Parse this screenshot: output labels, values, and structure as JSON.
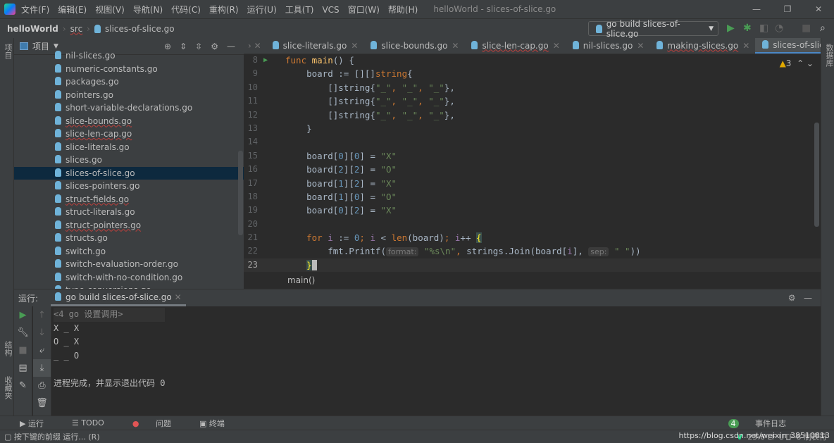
{
  "window": {
    "title": "helloWorld - slices-of-slice.go",
    "menu": [
      "文件(F)",
      "编辑(E)",
      "视图(V)",
      "导航(N)",
      "代码(C)",
      "重构(R)",
      "运行(U)",
      "工具(T)",
      "VCS",
      "窗口(W)",
      "帮助(H)"
    ]
  },
  "breadcrumb": {
    "project": "helloWorld",
    "folder": "src",
    "file": "slices-of-slice.go"
  },
  "run_config": {
    "label": "go build slices-of-slice.go"
  },
  "left_strip": {
    "project": "项目",
    "structure": "结构",
    "favorites": "收藏夹"
  },
  "right_strip": {
    "database": "数据库"
  },
  "project_panel": {
    "title": "项目",
    "files": [
      {
        "name": "nil-slices.go"
      },
      {
        "name": "numeric-constants.go"
      },
      {
        "name": "packages.go"
      },
      {
        "name": "pointers.go"
      },
      {
        "name": "short-variable-declarations.go"
      },
      {
        "name": "slice-bounds.go",
        "error": true
      },
      {
        "name": "slice-len-cap.go",
        "error": true
      },
      {
        "name": "slice-literals.go"
      },
      {
        "name": "slices.go"
      },
      {
        "name": "slices-of-slice.go",
        "selected": true
      },
      {
        "name": "slices-pointers.go"
      },
      {
        "name": "struct-fields.go",
        "error": true
      },
      {
        "name": "struct-literals.go"
      },
      {
        "name": "struct-pointers.go",
        "error": true
      },
      {
        "name": "structs.go"
      },
      {
        "name": "switch.go"
      },
      {
        "name": "switch-evaluation-order.go"
      },
      {
        "name": "switch-with-no-condition.go"
      },
      {
        "name": "type-conversions.go"
      }
    ]
  },
  "editor": {
    "tabs": [
      {
        "label": "slice-literals.go"
      },
      {
        "label": "slice-bounds.go"
      },
      {
        "label": "slice-len-cap.go",
        "error": true
      },
      {
        "label": "nil-slices.go"
      },
      {
        "label": "making-slices.go",
        "error": true
      },
      {
        "label": "slices-of-slice.go",
        "active": true
      }
    ],
    "warnings": "3",
    "breadcrumb": "main()",
    "current_line": 23,
    "lines": [
      {
        "n": 8,
        "t": [
          [
            "func ",
            "k"
          ],
          [
            "main",
            "f"
          ],
          [
            "() {",
            "d"
          ]
        ]
      },
      {
        "n": 9,
        "t": [
          [
            "    board := [][]",
            "d"
          ],
          [
            "string",
            "k"
          ],
          [
            "{",
            "d"
          ]
        ]
      },
      {
        "n": 10,
        "t": [
          [
            "        []string{",
            "d"
          ],
          [
            "\"_\"",
            "s"
          ],
          [
            ", ",
            "b"
          ],
          [
            "\"_\"",
            "s"
          ],
          [
            ", ",
            "b"
          ],
          [
            "\"_\"",
            "s"
          ],
          [
            "},",
            "d"
          ]
        ]
      },
      {
        "n": 11,
        "t": [
          [
            "        []string{",
            "d"
          ],
          [
            "\"_\"",
            "s"
          ],
          [
            ", ",
            "b"
          ],
          [
            "\"_\"",
            "s"
          ],
          [
            ", ",
            "b"
          ],
          [
            "\"_\"",
            "s"
          ],
          [
            "},",
            "d"
          ]
        ]
      },
      {
        "n": 12,
        "t": [
          [
            "        []string{",
            "d"
          ],
          [
            "\"_\"",
            "s"
          ],
          [
            ", ",
            "b"
          ],
          [
            "\"_\"",
            "s"
          ],
          [
            ", ",
            "b"
          ],
          [
            "\"_\"",
            "s"
          ],
          [
            "},",
            "d"
          ]
        ]
      },
      {
        "n": 13,
        "t": [
          [
            "    }",
            "d"
          ]
        ]
      },
      {
        "n": 14,
        "t": []
      },
      {
        "n": 15,
        "t": [
          [
            "    board[",
            "d"
          ],
          [
            "0",
            "n"
          ],
          [
            "][",
            "d"
          ],
          [
            "0",
            "n"
          ],
          [
            "] = ",
            "d"
          ],
          [
            "\"X\"",
            "s"
          ]
        ]
      },
      {
        "n": 16,
        "t": [
          [
            "    board[",
            "d"
          ],
          [
            "2",
            "n"
          ],
          [
            "][",
            "d"
          ],
          [
            "2",
            "n"
          ],
          [
            "] = ",
            "d"
          ],
          [
            "\"O\"",
            "s"
          ]
        ]
      },
      {
        "n": 17,
        "t": [
          [
            "    board[",
            "d"
          ],
          [
            "1",
            "n"
          ],
          [
            "][",
            "d"
          ],
          [
            "2",
            "n"
          ],
          [
            "] = ",
            "d"
          ],
          [
            "\"X\"",
            "s"
          ]
        ]
      },
      {
        "n": 18,
        "t": [
          [
            "    board[",
            "d"
          ],
          [
            "1",
            "n"
          ],
          [
            "][",
            "d"
          ],
          [
            "0",
            "n"
          ],
          [
            "] = ",
            "d"
          ],
          [
            "\"O\"",
            "s"
          ]
        ]
      },
      {
        "n": 19,
        "t": [
          [
            "    board[",
            "d"
          ],
          [
            "0",
            "n"
          ],
          [
            "][",
            "d"
          ],
          [
            "2",
            "n"
          ],
          [
            "] = ",
            "d"
          ],
          [
            "\"X\"",
            "s"
          ]
        ]
      },
      {
        "n": 20,
        "t": []
      },
      {
        "n": 21,
        "t": [
          [
            "    for ",
            "k"
          ],
          [
            "i",
            "p"
          ],
          [
            " := ",
            "d"
          ],
          [
            "0",
            "n"
          ],
          [
            "; ",
            "k"
          ],
          [
            "i",
            "p"
          ],
          [
            " < ",
            "d"
          ],
          [
            "len",
            "k"
          ],
          [
            "(board)",
            "d"
          ],
          [
            "; ",
            "k"
          ],
          [
            "i",
            "p"
          ],
          [
            "++ ",
            "d"
          ],
          [
            "{",
            "brace"
          ]
        ]
      },
      {
        "n": 22,
        "t": [
          [
            "        fmt.Printf(",
            "d"
          ],
          [
            "format:",
            "hint"
          ],
          [
            " ",
            "d"
          ],
          [
            "\"%s\\n\"",
            "s"
          ],
          [
            ", ",
            "b"
          ],
          [
            "strings.Join(board[",
            "d"
          ],
          [
            "i",
            "p"
          ],
          [
            "], ",
            "d"
          ],
          [
            "sep:",
            "hint"
          ],
          [
            " ",
            "d"
          ],
          [
            "\" \"",
            "s"
          ],
          [
            "))",
            "d"
          ]
        ]
      },
      {
        "n": 23,
        "t": [
          [
            "    ",
            "d"
          ],
          [
            "}",
            "brace"
          ]
        ]
      }
    ]
  },
  "run_panel": {
    "label": "运行:",
    "tab": "go build slices-of-slice.go",
    "output": [
      "<4 go 设置调用>",
      "X _ X",
      "O _ X",
      "_ _ O",
      "",
      "进程完成，并显示退出代码 0"
    ]
  },
  "tool_tabs": {
    "run": "运行",
    "todo": "TODO",
    "problems": "问题",
    "terminal": "终端",
    "events_count": "4",
    "events": "事件日志"
  },
  "status": {
    "message": "按下键的前缀 运行... (R)",
    "position": "23:6",
    "line_sep": "LF",
    "encoding": "UTF-8",
    "indent": "制表符"
  },
  "watermark": "https://blog.csdn.net/weixin_38510813",
  "colors": {
    "keyword": "#cc7832",
    "string": "#6a8759",
    "number": "#6897bb",
    "function": "#ffc66d",
    "selection": "#0d293e",
    "run_green": "#499c54"
  }
}
